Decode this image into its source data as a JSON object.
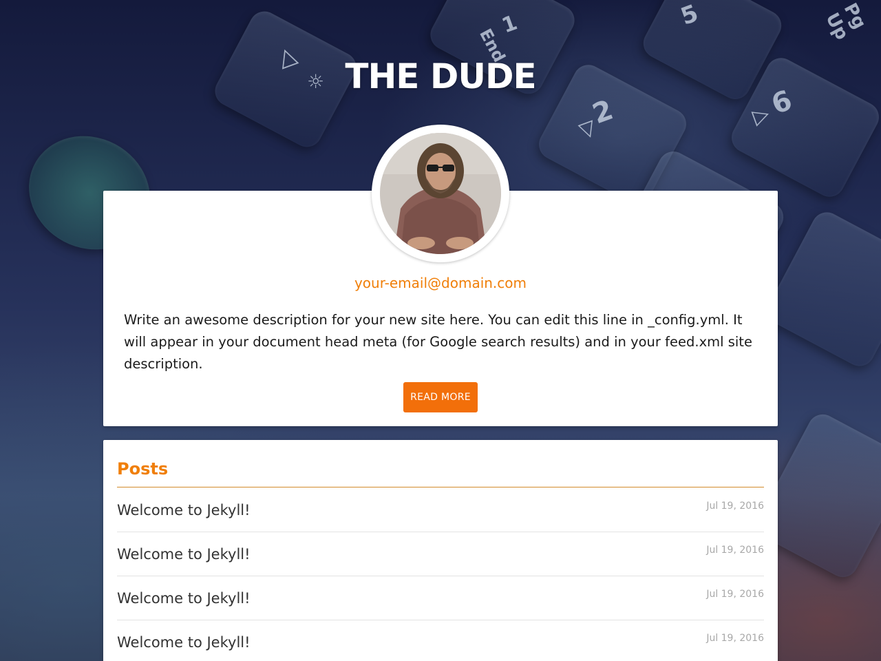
{
  "site": {
    "title": "THE DUDE"
  },
  "profile": {
    "avatar_alt": "avatar",
    "email": "your-email@domain.com",
    "description": "Write an awesome description for your new site here. You can edit this line in _config.yml. It will appear in your document head meta (for Google search results) and in your feed.xml site description.",
    "read_more_label": "READ MORE"
  },
  "posts": {
    "heading": "Posts",
    "items": [
      {
        "title": "Welcome to Jekyll!",
        "date": "Jul 19, 2016"
      },
      {
        "title": "Welcome to Jekyll!",
        "date": "Jul 19, 2016"
      },
      {
        "title": "Welcome to Jekyll!",
        "date": "Jul 19, 2016"
      },
      {
        "title": "Welcome to Jekyll!",
        "date": "Jul 19, 2016"
      }
    ]
  },
  "colors": {
    "accent": "#f07f09",
    "button": "#f26f0a",
    "card": "#ffffff"
  }
}
